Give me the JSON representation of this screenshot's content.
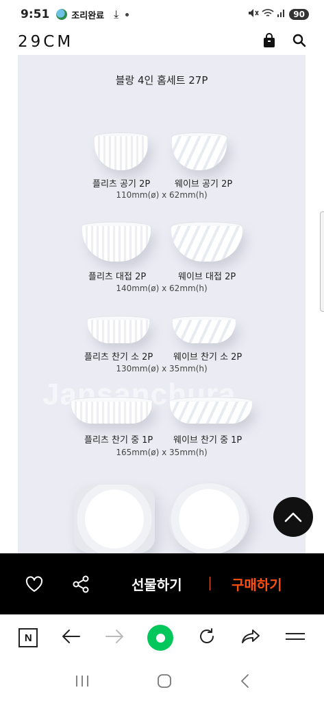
{
  "status_bar": {
    "time": "9:51",
    "notification_text": "조리완료",
    "battery": "90"
  },
  "header": {
    "logo": "29CM"
  },
  "product_image": {
    "title": "블랑 4인 홈세트 27P",
    "watermark": "Jansanchura",
    "items": [
      {
        "left": "플리츠 공기 2P",
        "right": "웨이브 공기 2P",
        "dims": "110mm(ø) x 62mm(h)"
      },
      {
        "left": "플리츠 대접 2P",
        "right": "웨이브 대접 2P",
        "dims": "140mm(ø) x 62mm(h)"
      },
      {
        "left": "플리츠 찬기 소 2P",
        "right": "웨이브 찬기 소 2P",
        "dims": "130mm(ø) x 35mm(h)"
      },
      {
        "left": "플리츠 찬기 중 1P",
        "right": "웨이브 찬기 중 1P",
        "dims": "165mm(ø) x 35mm(h)"
      }
    ]
  },
  "action_bar": {
    "gift_label": "선물하기",
    "buy_label": "구매하기",
    "accent_color": "#ff4e0d"
  },
  "browser_bar": {
    "n_label": "N"
  }
}
